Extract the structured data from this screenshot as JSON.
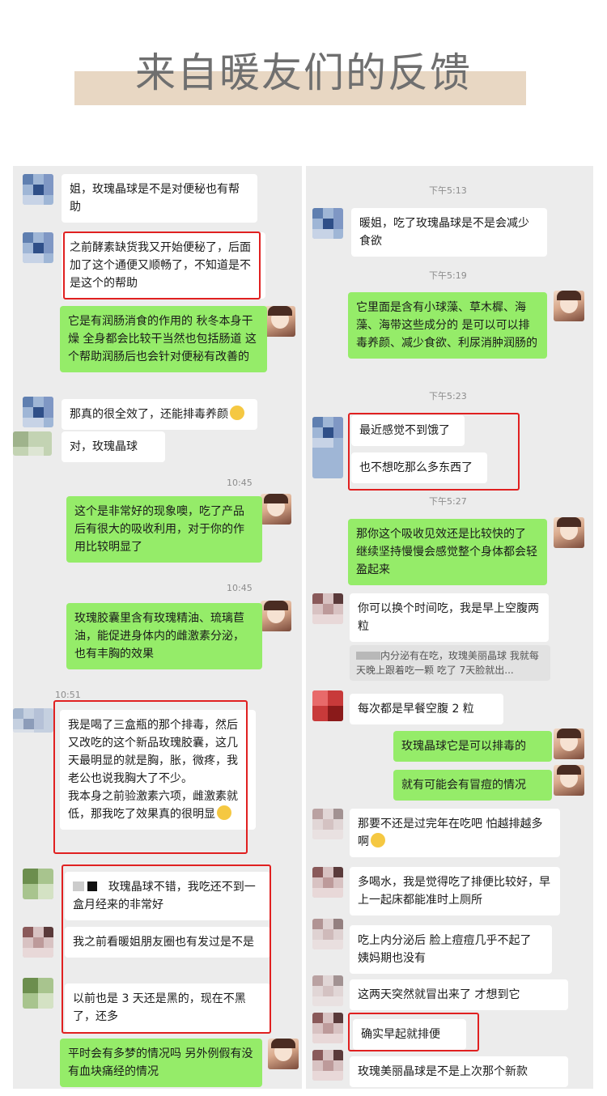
{
  "page": {
    "title": "来自暖友们的反馈"
  },
  "colors": {
    "green_bubble": "#95ec69",
    "white_bubble": "#ffffff",
    "highlight": "#e02020",
    "band": "#e8d7c3"
  },
  "left": {
    "m1": "姐，玫瑰晶球是不是对便秘也有帮助",
    "m2": "之前酵素缺货我又开始便秘了，后面加了这个通便又顺畅了，不知道是不是这个的帮助",
    "m3": "它是有润肠消食的作用的 秋冬本身干燥 全身都会比较干当然也包括肠道 这个帮助润肠后也会针对便秘有改善的",
    "m4": "那真的很全效了，还能排毒养颜",
    "m5": "对，玫瑰晶球",
    "t1": "10:45",
    "m6": "这个是非常好的现象噢，吃了产品后有很大的吸收利用，对于你的作用比较明显了",
    "t2": "10:45",
    "m7": "玫瑰胶囊里含有玫瑰精油、琉璃苣油，能促进身体内的雌激素分泌，也有丰胸的效果",
    "t3": "10:51",
    "m8": "我是喝了三盒瓶的那个排毒，然后又改吃的这个新品玫瑰胶囊，这几天最明显的就是胸，胀，微疼，我老公也说我胸大了不少。\n我本身之前验激素六项，雌激素就低，那我吃了效果真的很明显",
    "m9": "玫瑰晶球不错，我吃还不到一盒月经来的非常好",
    "m10": "我之前看暖姐朋友圈也有发过是不是",
    "m11": "以前也是 3 天还是黑的，现在不黑了，还多",
    "m12": "平时会有多梦的情况吗 另外例假有没有血块痛经的情况"
  },
  "right": {
    "t1": "下午5:13",
    "m1": "暖姐，吃了玫瑰晶球是不是会减少食欲",
    "t2": "下午5:19",
    "m2": "它里面是含有小球藻、草木樨、海藻、海带这些成分的 是可以可以排毒养颜、减少食欲、利尿消肿润肠的",
    "t3": "下午5:23",
    "m3": "最近感觉不到饿了",
    "m4": "也不想吃那么多东西了",
    "t4": "下午5:27",
    "m5": "那你这个吸收见效还是比较快的了 继续坚持慢慢会感觉整个身体都会轻盈起来",
    "m6": "你可以换个时间吃，我是早上空腹两粒",
    "quote": "内分泌有在吃，玫瑰美丽晶球 我就每天晚上跟着吃一颗 吃了 7天脸就出...",
    "m7": "每次都是早餐空腹 2 粒",
    "m8": "玫瑰晶球它是可以排毒的",
    "m9": "就有可能会有冒痘的情况",
    "m10": "那要不还是过完年在吃吧 怕越排越多啊",
    "m11": "多喝水，我是觉得吃了排便比较好，早上一起床都能准时上厕所",
    "m12": "吃上内分泌后 脸上痘痘几乎不起了 姨妈期也没有",
    "m13": "这两天突然就冒出来了 才想到它",
    "m14": "确实早起就排便",
    "m15": "玫瑰美丽晶球是不是上次那个新款"
  }
}
